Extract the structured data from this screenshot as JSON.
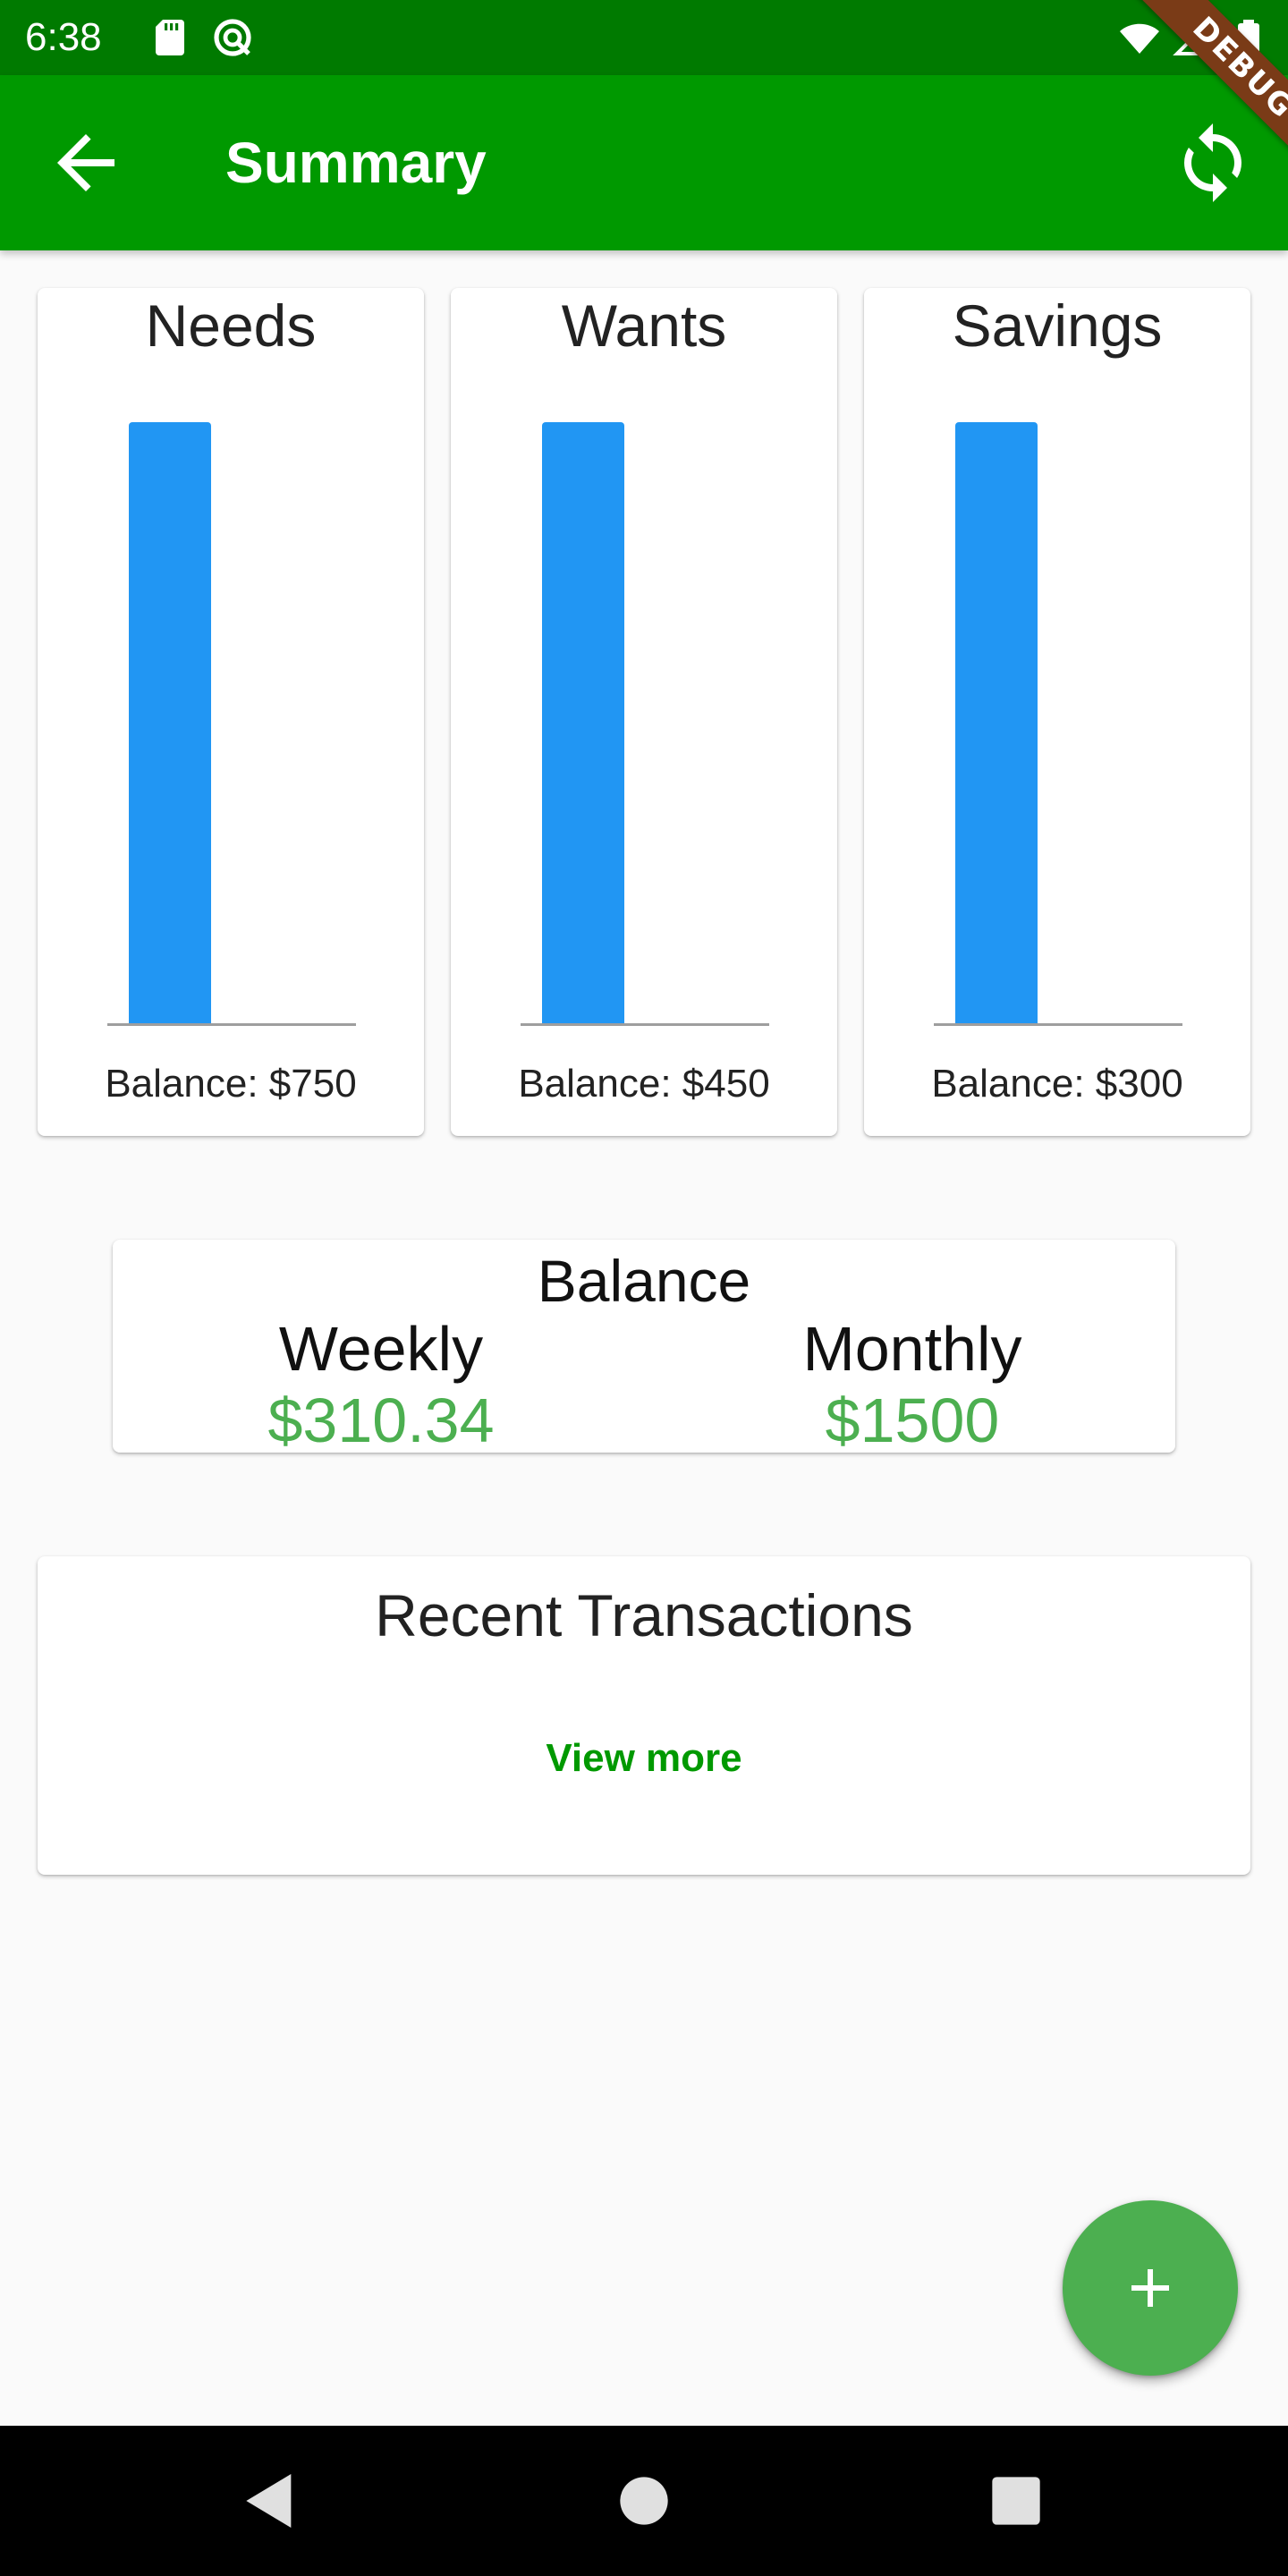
{
  "status_bar": {
    "time": "6:38",
    "icons": [
      "sd-card-icon",
      "vpn-icon",
      "wifi-icon",
      "signal-icon",
      "battery-icon"
    ]
  },
  "debug_banner": "DEBUG",
  "app_bar": {
    "title": "Summary",
    "back_icon": "arrow-back-icon",
    "refresh_icon": "refresh-icon"
  },
  "budget_cards": [
    {
      "title": "Needs",
      "balance": "Balance: $750"
    },
    {
      "title": "Wants",
      "balance": "Balance: $450"
    },
    {
      "title": "Savings",
      "balance": "Balance: $300"
    }
  ],
  "chart_data": [
    {
      "type": "bar",
      "title": "Needs",
      "categories": [
        ""
      ],
      "values": [
        1
      ],
      "color": "#2196f3"
    },
    {
      "type": "bar",
      "title": "Wants",
      "categories": [
        ""
      ],
      "values": [
        1
      ],
      "color": "#2196f3"
    },
    {
      "type": "bar",
      "title": "Savings",
      "categories": [
        ""
      ],
      "values": [
        1
      ],
      "color": "#2196f3"
    }
  ],
  "balance": {
    "title": "Balance",
    "weekly_label": "Weekly",
    "weekly_amount": "$310.34",
    "monthly_label": "Monthly",
    "monthly_amount": "$1500"
  },
  "transactions": {
    "title": "Recent Transactions",
    "view_more": "View more"
  },
  "fab": {
    "icon": "add-icon"
  },
  "colors": {
    "status_bar": "#007a00",
    "app_bar": "#009900",
    "bar": "#2196f3",
    "amount": "#4caf50",
    "fab": "#4caf50",
    "link": "#009900"
  }
}
